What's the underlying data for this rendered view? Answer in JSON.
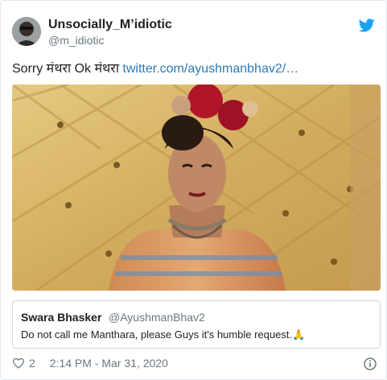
{
  "tweet": {
    "author_name": "Unsocially_M’idiotic",
    "author_handle": "@m_idiotic",
    "text_prefix": "Sorry मंथरा Ok मंथरा ",
    "link_text": "twitter.com/ayushmanbhav2/…",
    "likes": "2",
    "timestamp": "2:14 PM - Mar 31, 2020"
  },
  "quoted": {
    "author_name": "Swara Bhasker",
    "author_handle": "@AyushmanBhav2",
    "text": "Do not call me Manthara, please Guys it's humble request.🙏"
  },
  "icons": {
    "brand": "twitter-bird-icon",
    "like": "heart-icon",
    "info": "info-icon"
  },
  "colors": {
    "link": "#2b7bb9",
    "brand": "#1da1f2",
    "secondary_text": "#697882",
    "border": "#e1e8ed"
  }
}
